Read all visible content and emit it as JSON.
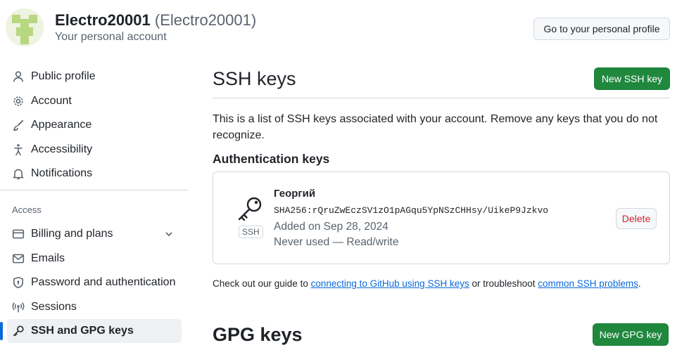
{
  "header": {
    "account_name": "Electro20001",
    "account_login": "(Electro20001)",
    "account_subtitle": "Your personal account",
    "profile_button": "Go to your personal profile"
  },
  "sidebar": {
    "items": [
      {
        "label": "Public profile",
        "icon": "person-icon"
      },
      {
        "label": "Account",
        "icon": "gear-icon"
      },
      {
        "label": "Appearance",
        "icon": "paintbrush-icon"
      },
      {
        "label": "Accessibility",
        "icon": "accessibility-icon"
      },
      {
        "label": "Notifications",
        "icon": "bell-icon"
      }
    ],
    "access_heading": "Access",
    "access_items": [
      {
        "label": "Billing and plans",
        "icon": "credit-card-icon"
      },
      {
        "label": "Emails",
        "icon": "mail-icon"
      },
      {
        "label": "Password and authentication",
        "icon": "shield-lock-icon"
      },
      {
        "label": "Sessions",
        "icon": "broadcast-icon"
      },
      {
        "label": "SSH and GPG keys",
        "icon": "key-icon",
        "active": true
      }
    ]
  },
  "main": {
    "title": "SSH keys",
    "new_ssh_button": "New SSH key",
    "description": "This is a list of SSH keys associated with your account. Remove any keys that you do not recognize.",
    "auth_keys_title": "Authentication keys",
    "key": {
      "name": "Георгий",
      "fingerprint": "SHA256:rQruZwEczSV1zO1pAGqu5YpNSzCHHsy/UikeP9Jzkvo",
      "added": "Added on Sep 28, 2024",
      "usage": "Never used — Read/write",
      "type_label": "SSH",
      "delete_button": "Delete"
    },
    "guide": {
      "prefix": "Check out our guide to ",
      "link1": "connecting to GitHub using SSH keys",
      "middle": " or troubleshoot ",
      "link2": "common SSH problems",
      "suffix": "."
    },
    "gpg_title": "GPG keys",
    "new_gpg_button": "New GPG key"
  },
  "colors": {
    "primary_button": "#1f883d",
    "link": "#0969da",
    "danger": "#d1242f",
    "active_indicator": "#0969da"
  }
}
